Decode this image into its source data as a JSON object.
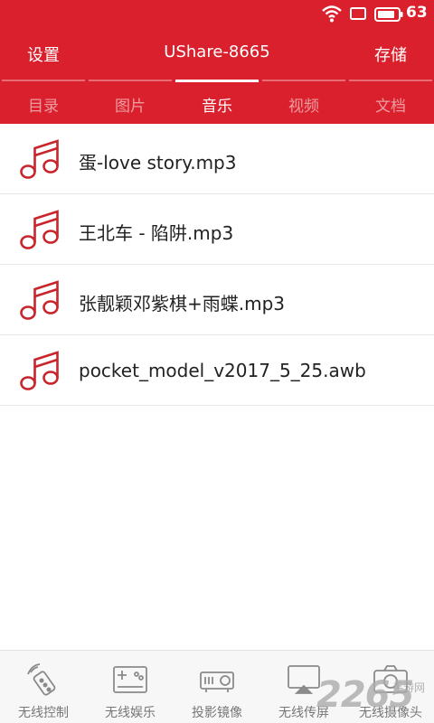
{
  "status_bar": {
    "battery_level": "63"
  },
  "app_bar": {
    "left_label": "设置",
    "title": "UShare-8665",
    "right_label": "存储"
  },
  "tabs": [
    {
      "label": "目录",
      "active": false
    },
    {
      "label": "图片",
      "active": false
    },
    {
      "label": "音乐",
      "active": true
    },
    {
      "label": "视频",
      "active": false
    },
    {
      "label": "文档",
      "active": false
    }
  ],
  "files": [
    {
      "name": "蛋-love story.mp3",
      "icon": "music-note-icon"
    },
    {
      "name": "王北车 - 陷阱.mp3",
      "icon": "music-note-icon"
    },
    {
      "name": "张靓颖邓紫棋+雨蝶.mp3",
      "icon": "music-note-icon"
    },
    {
      "name": "pocket_model_v2017_5_25.awb",
      "icon": "music-note-icon"
    }
  ],
  "bottom_nav": [
    {
      "label": "无线控制",
      "icon": "remote-control-icon"
    },
    {
      "label": "无线娱乐",
      "icon": "gamepad-icon"
    },
    {
      "label": "投影镜像",
      "icon": "projector-icon"
    },
    {
      "label": "无线传屏",
      "icon": "screen-cast-icon"
    },
    {
      "label": "无线摄像头",
      "icon": "camera-icon"
    }
  ],
  "watermark": {
    "number": "2265",
    "text": "手游网"
  },
  "colors": {
    "primary": "#d9202c",
    "icon_red": "#c8252c"
  }
}
